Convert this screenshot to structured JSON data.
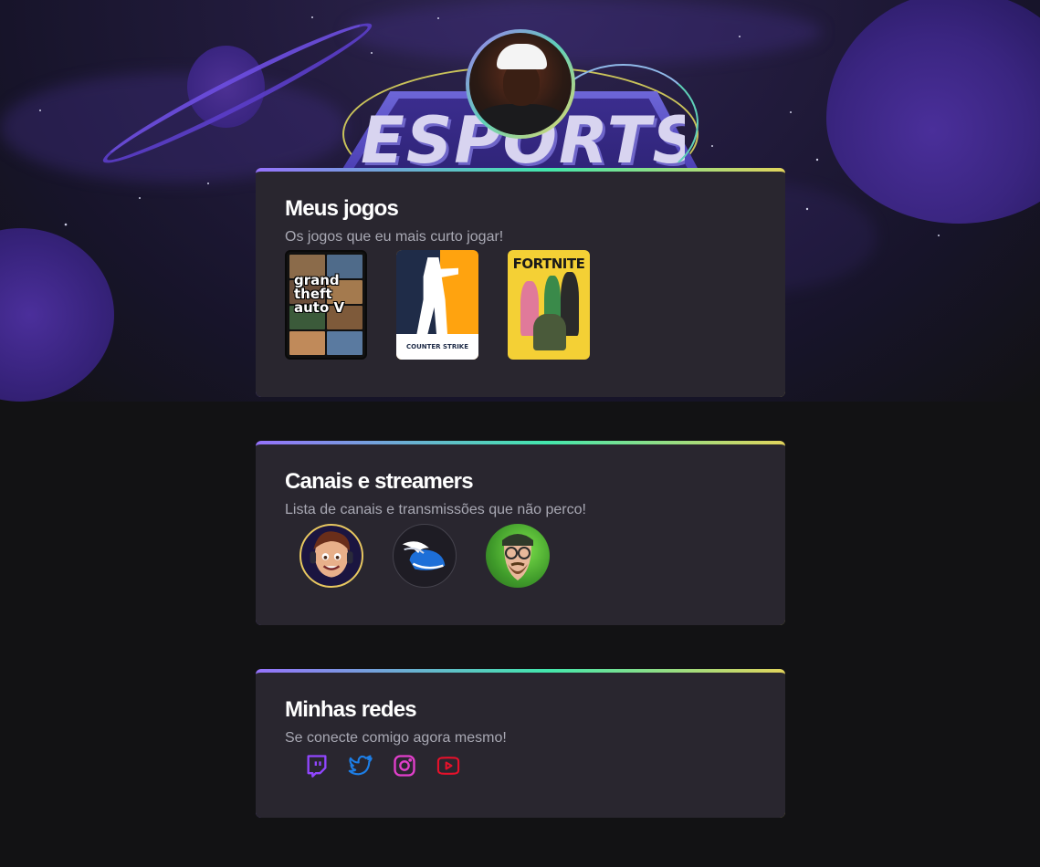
{
  "profile": {
    "avatar_alt": "Foto de perfil",
    "logo_text": "ESPORTS"
  },
  "colors": {
    "background": "#121214",
    "card": "#29262f",
    "gradient": [
      "#9572fc",
      "#43e7ad",
      "#e2d45c"
    ],
    "twitch": "#9146ff",
    "twitter": "#1d7ee6",
    "instagram": "#e13fcb",
    "youtube": "#e6112b"
  },
  "games": {
    "title": "Meus jogos",
    "subtitle": "Os jogos que eu mais curto jogar!",
    "items": [
      {
        "name": "Grand Theft Auto V",
        "cover_text": "grand theft auto V"
      },
      {
        "name": "Counter-Strike",
        "cover_text": "COUNTER STRIKE"
      },
      {
        "name": "Fortnite",
        "cover_text": "FORTNITE"
      }
    ]
  },
  "streamers": {
    "title": "Canais e streamers",
    "subtitle": "Lista de canais e transmissões que não perco!",
    "items": [
      {
        "icon": "gamer-headset-avatar"
      },
      {
        "icon": "winged-helmet-avatar"
      },
      {
        "icon": "bearded-glasses-avatar"
      }
    ]
  },
  "social": {
    "title": "Minhas redes",
    "subtitle": "Se conecte comigo agora mesmo!",
    "items": [
      {
        "icon": "twitch-icon"
      },
      {
        "icon": "twitter-icon"
      },
      {
        "icon": "instagram-icon"
      },
      {
        "icon": "youtube-icon"
      }
    ]
  }
}
